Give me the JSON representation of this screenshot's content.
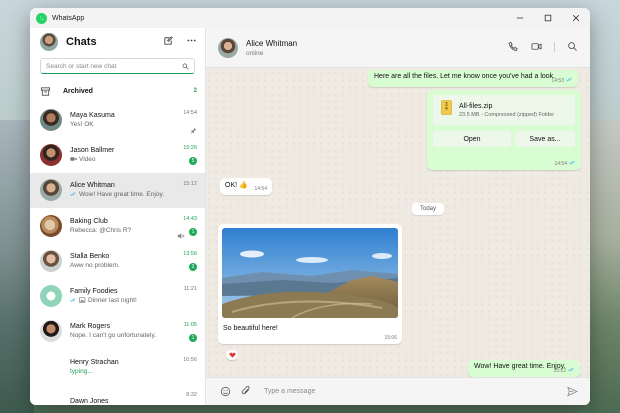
{
  "app": {
    "title": "WhatsApp",
    "accent": "#25d366",
    "green_text": "#1f9f58",
    "out_bubble": "#d9fdd3"
  },
  "sidebar": {
    "title": "Chats",
    "search_placeholder": "Search or start new chat",
    "archived": {
      "label": "Archived",
      "count": "2"
    },
    "chats": [
      {
        "name": "Maya Kasuma",
        "preview": "Yes! OK",
        "time": "14:54",
        "pinned": true
      },
      {
        "name": "Jason Ballmer",
        "preview": "Video",
        "time": "15:26",
        "unread": "5",
        "time_green": true,
        "icon": "video-icon"
      },
      {
        "name": "Alice Whitman",
        "preview": "Wow! Have great time. Enjoy.",
        "time": "15:12",
        "active": true,
        "read": true
      },
      {
        "name": "Baking Club",
        "preview": "Rebecca: @Chris R?",
        "time": "14:43",
        "unread": "1",
        "time_green": true,
        "muted": true
      },
      {
        "name": "Stalla Benko",
        "preview": "Aww no problem.",
        "time": "13:56",
        "unread": "2",
        "time_green": true
      },
      {
        "name": "Family Foodies",
        "preview": "Dinner last night!",
        "time": "11:21",
        "read": true,
        "icon": "image-icon"
      },
      {
        "name": "Mark Rogers",
        "preview": "Nope. I can't go unfortunately.",
        "time": "11:05",
        "unread": "1",
        "time_green": true
      },
      {
        "name": "Henry Strachan",
        "preview": "typing...",
        "time": "10:56",
        "typing": true
      },
      {
        "name": "Dawn Jones",
        "preview": "",
        "time": "8:32"
      }
    ]
  },
  "conversation": {
    "contact_name": "Alice Whitman",
    "contact_status": "online",
    "date_separator": "Today",
    "composer_placeholder": "Type a message",
    "messages": {
      "m1": {
        "text": "Here are all the files. Let me know once you've had a look.",
        "time": "14:53"
      },
      "file": {
        "name": "All-files.zip",
        "meta": "23.5 MB - Compressed (zipped) Folder",
        "open_label": "Open",
        "save_label": "Save as...",
        "time": "14:54"
      },
      "m2": {
        "text": "OK! 👍",
        "time": "14:54"
      },
      "photo": {
        "caption": "So beautiful here!",
        "time": "15:06",
        "reaction": "heart"
      },
      "m3": {
        "text": "Wow! Have great time. Enjoy.",
        "time": "15:12"
      }
    }
  }
}
